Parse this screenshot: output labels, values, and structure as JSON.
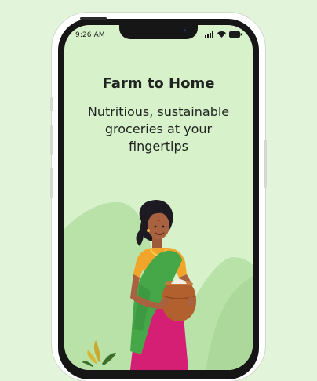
{
  "status_bar": {
    "time": "9:26 AM",
    "icons": [
      "cellular-signal-icon",
      "wifi-icon",
      "battery-icon"
    ]
  },
  "onboarding": {
    "title": "Farm to Home",
    "subtitle": "Nutritious, sustainable groceries at your fingertips"
  },
  "colors": {
    "background": "#e2f4da",
    "screen": "#d7f2cb",
    "hills": "#b9e2a9",
    "saree_green": "#46a748",
    "saree_pink": "#d41f74",
    "blouse_orange": "#f2a52b",
    "pot": "#b2602d"
  }
}
